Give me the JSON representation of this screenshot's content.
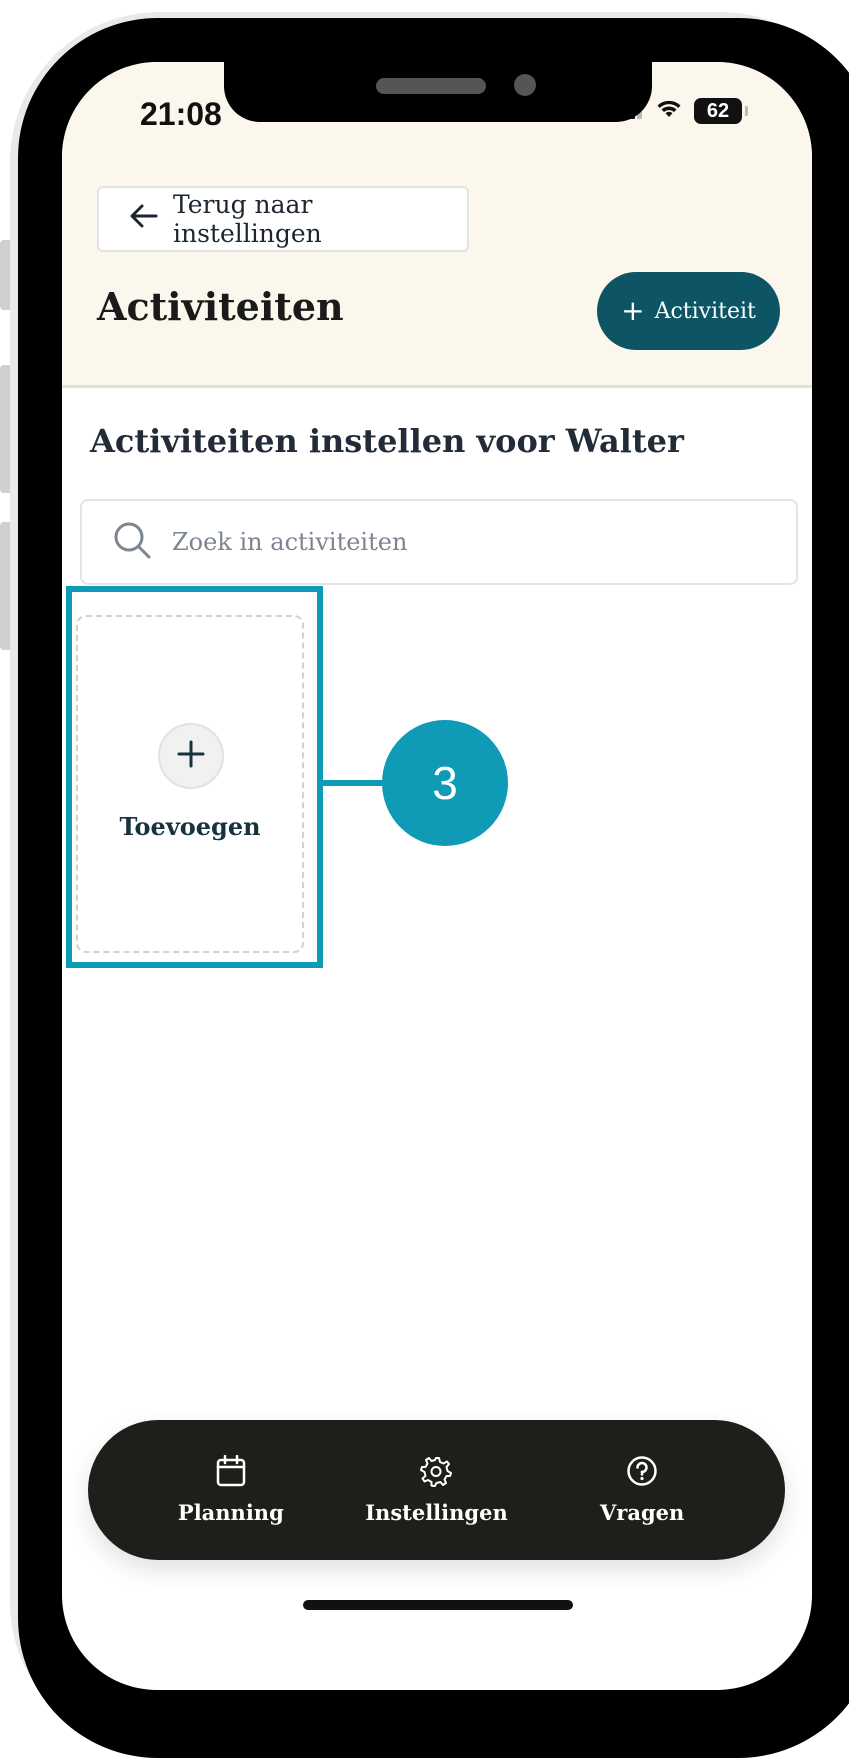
{
  "status_bar": {
    "time": "21:08",
    "battery": "62",
    "icons": [
      "signal-icon",
      "wifi-icon",
      "battery-icon"
    ]
  },
  "header": {
    "back_label": "Terug naar instellingen",
    "title": "Activiteiten",
    "add_button_label": "Activiteit"
  },
  "main": {
    "subtitle": "Activiteiten instellen voor Walter",
    "search_placeholder": "Zoek in activiteiten",
    "add_card_label": "Toevoegen"
  },
  "bottom_nav": {
    "items": [
      {
        "label": "Planning",
        "icon": "calendar-icon"
      },
      {
        "label": "Instellingen",
        "icon": "gear-icon"
      },
      {
        "label": "Vragen",
        "icon": "question-icon"
      }
    ]
  },
  "annotation": {
    "step_number": "3",
    "color": "#0f9bb5"
  },
  "colors": {
    "header_bg": "#fbf7ec",
    "primary_button": "#0d5565",
    "nav_bg": "#1f1e1a"
  }
}
